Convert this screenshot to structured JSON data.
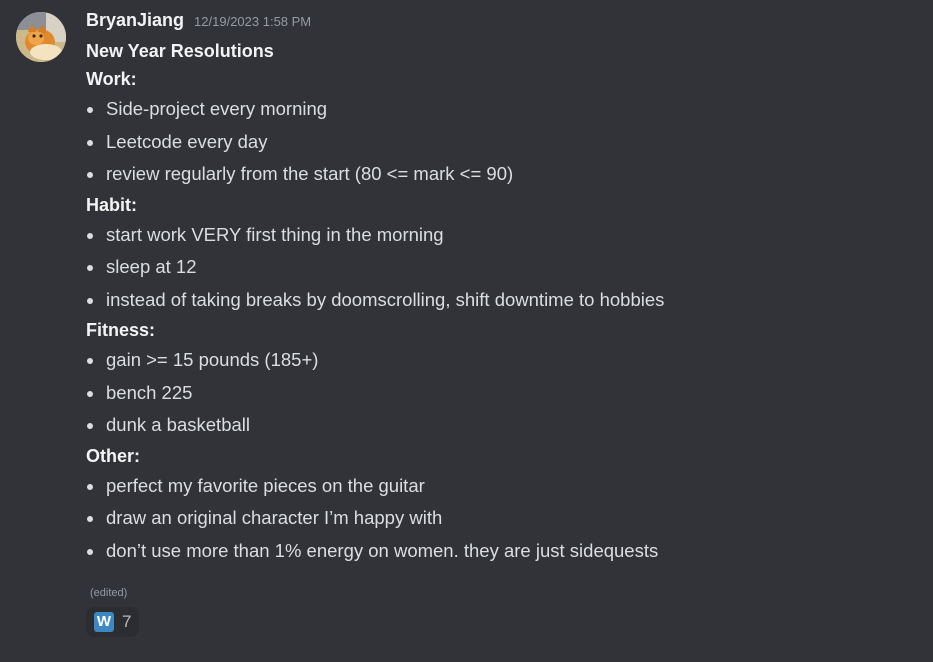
{
  "message": {
    "author": "BryanJiang",
    "timestamp": "12/19/2023 1:58 PM",
    "heading": "New Year Resolutions",
    "sections": [
      {
        "title": "Work:",
        "items": [
          "Side-project every morning",
          "Leetcode every day",
          "review regularly from the start (80 <= mark <= 90)"
        ]
      },
      {
        "title": "Habit:",
        "items": [
          "start work VERY first thing in the morning",
          "sleep at 12",
          "instead of taking breaks by doomscrolling, shift downtime to hobbies"
        ]
      },
      {
        "title": "Fitness:",
        "items": [
          "gain >= 15 pounds (185+)",
          "bench 225",
          "dunk a basketball"
        ]
      },
      {
        "title": "Other:",
        "items": [
          "perfect my favorite pieces on the guitar",
          "draw an original character I’m happy with",
          "don’t use more than 1% energy on women. they are just sidequests"
        ]
      }
    ],
    "edited_label": "(edited)",
    "reaction": {
      "emoji": "W",
      "emoji_name": "regional-indicator-w-icon",
      "count": "7",
      "emoji_color": "#3b88c3"
    }
  },
  "colors": {
    "background": "#313338",
    "text": "#dbdee1",
    "muted": "#949ba4",
    "reaction_bg": "#2b2d31"
  }
}
